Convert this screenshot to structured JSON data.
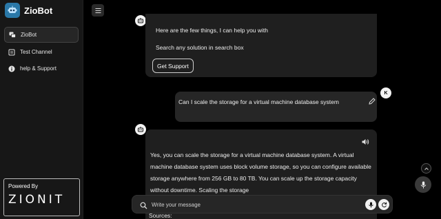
{
  "brand": {
    "name": "ZioBot"
  },
  "sidebar": {
    "items": [
      {
        "label": "ZioBot",
        "icon": "chat-icon",
        "active": true
      },
      {
        "label": "Test Channel",
        "icon": "channel-icon",
        "active": false
      },
      {
        "label": "help & Support",
        "icon": "info-icon",
        "active": false
      }
    ],
    "powered_by": {
      "label": "Powered By",
      "logo_text": "ZIONIT"
    }
  },
  "chat": {
    "bot_message_1": {
      "line1": "Here are the few things, I can help you with",
      "line2": "Search any solution in search box",
      "button": "Get Support"
    },
    "user_message": {
      "text": "Can I scale the storage for a virtual machine database system",
      "avatar_initial": "K"
    },
    "bot_message_2": {
      "text": "Yes, you can scale the storage for a virtual machine database system. A virtual machine database system uses block volume storage, so you can configure available storage anywhere from 256 GB to 80 TB. You can scale up the storage capacity without downtime. Scaling the storage",
      "sources_label": "Sources:"
    }
  },
  "input": {
    "placeholder": "Write your message"
  },
  "colors": {
    "background": "#000000",
    "sidebar": "#171717",
    "bubble": "#1f1f1f",
    "accent": "#2a78a8"
  }
}
